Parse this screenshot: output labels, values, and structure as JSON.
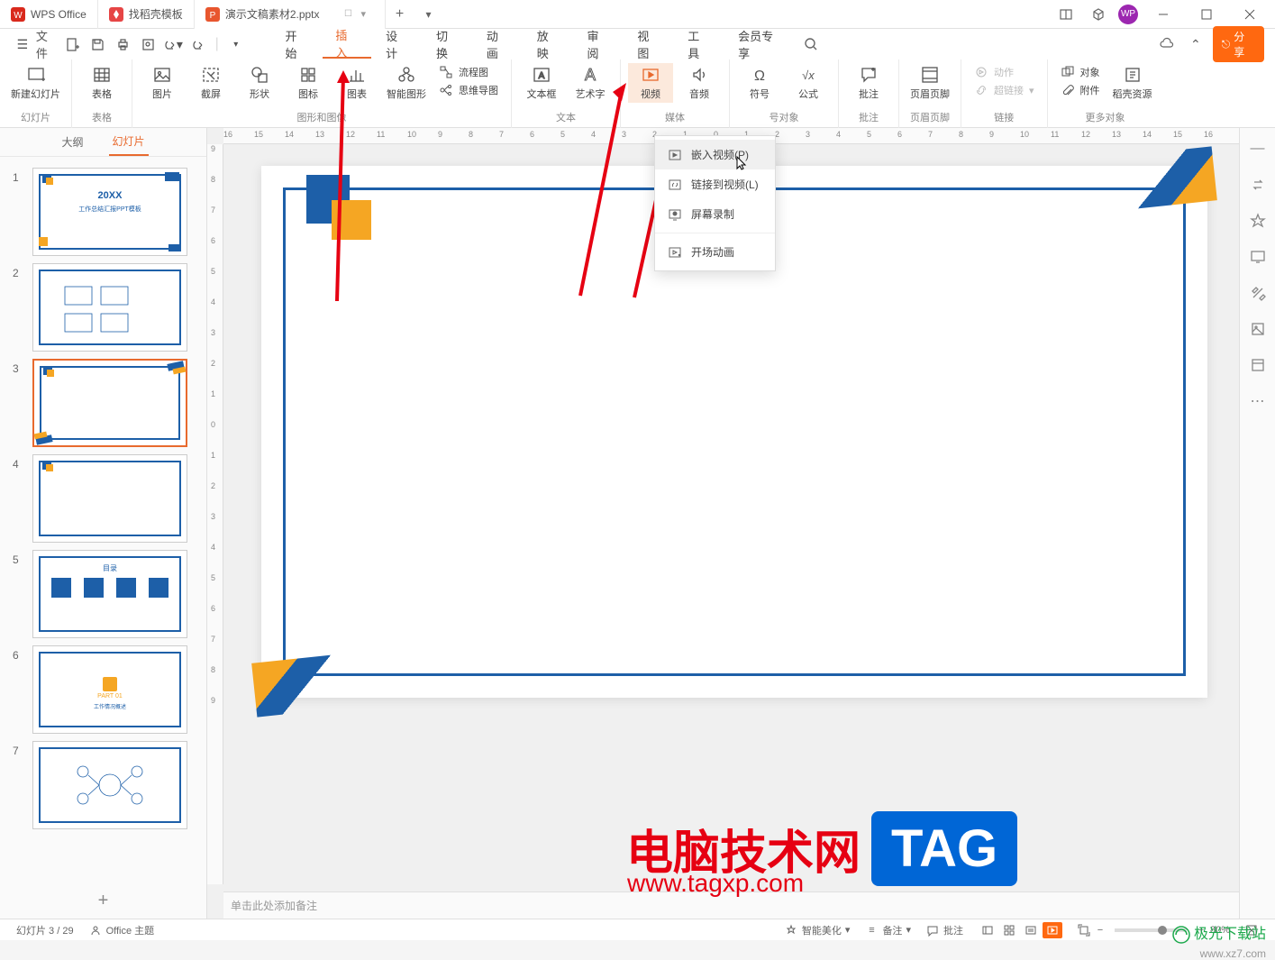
{
  "titlebar": {
    "app_name": "WPS Office",
    "tab2": "找稻壳模板",
    "tab3": "演示文稿素材2.pptx"
  },
  "qat": {
    "file": "文件"
  },
  "menu": {
    "start": "开始",
    "insert": "插入",
    "design": "设计",
    "transition": "切换",
    "animation": "动画",
    "slideshow": "放映",
    "review": "审阅",
    "view": "视图",
    "tools": "工具",
    "member": "会员专享"
  },
  "share": "分享",
  "ribbon": {
    "new_slide": "新建幻灯片",
    "grp_slide": "幻灯片",
    "table": "表格",
    "grp_table": "表格",
    "image": "图片",
    "screenshot": "截屏",
    "shapes": "形状",
    "icons": "图标",
    "chart": "图表",
    "smartart": "智能图形",
    "flowchart": "流程图",
    "mindmap": "思维导图",
    "grp_graphics": "图形和图像",
    "textbox": "文本框",
    "wordart": "艺术字",
    "grp_text": "文本",
    "video": "视频",
    "audio": "音频",
    "grp_media": "媒体",
    "symbol": "符号",
    "equation": "公式",
    "grp_symbol": "号对象",
    "comment": "批注",
    "grp_comment": "批注",
    "header_footer": "页眉页脚",
    "grp_header": "页眉页脚",
    "action": "动作",
    "hyperlink": "超链接",
    "grp_link": "链接",
    "object": "对象",
    "attachment": "附件",
    "docer": "稻壳资源",
    "grp_more": "更多对象"
  },
  "dropdown": {
    "embed_video": "嵌入视频(P)",
    "link_video": "链接到视频(L)",
    "screen_record": "屏幕录制",
    "opening_animation": "开场动画"
  },
  "outline": {
    "outline_tab": "大纲",
    "slides_tab": "幻灯片",
    "slide1_title": "20XX",
    "slide1_subtitle": "工作总结汇报PPT模板"
  },
  "ruler_h": [
    "16",
    "15",
    "14",
    "13",
    "12",
    "11",
    "10",
    "9",
    "8",
    "7",
    "6",
    "5",
    "4",
    "3",
    "2",
    "1",
    "0",
    "1",
    "2",
    "3",
    "4",
    "5",
    "6",
    "7",
    "8",
    "9",
    "10",
    "11",
    "12",
    "13",
    "14",
    "15",
    "16"
  ],
  "ruler_v": [
    "9",
    "8",
    "7",
    "6",
    "5",
    "4",
    "3",
    "2",
    "1",
    "0",
    "1",
    "2",
    "3",
    "4",
    "5",
    "6",
    "7",
    "8",
    "9"
  ],
  "notes_placeholder": "单击此处添加备注",
  "statusbar": {
    "slide_pos": "幻灯片 3 / 29",
    "theme": "Office 主题",
    "beautify": "智能美化",
    "notes": "备注",
    "comments": "批注",
    "zoom_pct": "80%"
  },
  "watermark": {
    "text1": "电脑技术网",
    "url": "www.tagxp.com",
    "tag": "TAG",
    "jiguang": "极光下载站",
    "xz7": "www.xz7.com"
  }
}
